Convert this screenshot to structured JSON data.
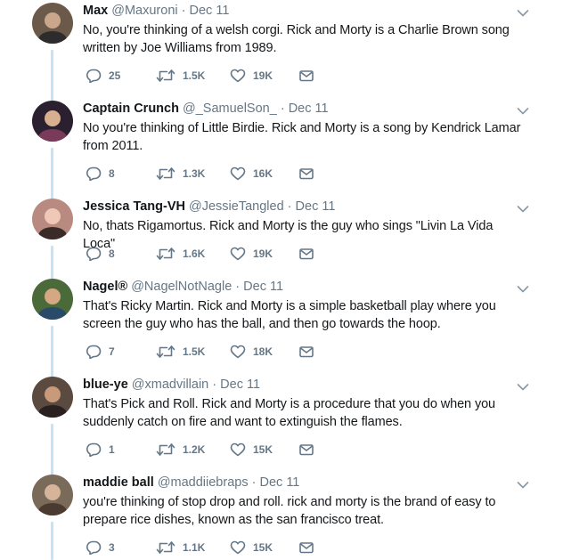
{
  "colors": {
    "thread": "#c4e4f5",
    "muted": "#657786",
    "text": "#14171a"
  },
  "tweets": [
    {
      "name": "Max",
      "handle": "@Maxuroni",
      "date": "Dec 11",
      "text": "No, you're thinking of a welsh corgi. Rick and Morty is a Charlie Brown song written by Joe Williams from 1989.",
      "replies": "25",
      "retweets": "1.5K",
      "likes": "19K"
    },
    {
      "name": "Captain Crunch",
      "handle": "@_SamuelSon_",
      "date": "Dec 11",
      "text": "No you're thinking of Little Birdie. Rick and Morty is a song by Kendrick Lamar from 2011.",
      "replies": "8",
      "retweets": "1.3K",
      "likes": "16K"
    },
    {
      "name": "Jessica Tang-VH",
      "handle": "@JessieTangled",
      "date": "Dec 11",
      "text": "No, thats Rigamortus. Rick and Morty is the guy who sings \"Livin La Vida Loca\"",
      "replies": "8",
      "retweets": "1.6K",
      "likes": "19K"
    },
    {
      "name": "Nagel®",
      "handle": "@NagelNotNagle",
      "date": "Dec 11",
      "text": "That's Ricky Martin. Rick and Morty is a simple basketball play where you screen the guy who has the ball, and then go towards the hoop.",
      "replies": "7",
      "retweets": "1.5K",
      "likes": "18K"
    },
    {
      "name": "blue-ye",
      "handle": "@xmadvillain",
      "date": "Dec 11",
      "text": "That's Pick and Roll. Rick and Morty is a procedure that you do when you suddenly catch on fire and want to extinguish the flames.",
      "replies": "1",
      "retweets": "1.2K",
      "likes": "15K"
    },
    {
      "name": "maddie ball",
      "handle": "@maddiiebraps",
      "date": "Dec 11",
      "text": "you're thinking of stop drop and roll. rick and morty is the brand of easy to prepare rice dishes, known as the san francisco treat.",
      "replies": "3",
      "retweets": "1.1K",
      "likes": "15K"
    }
  ]
}
